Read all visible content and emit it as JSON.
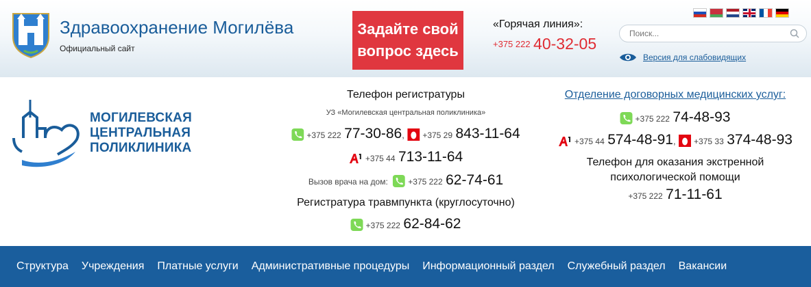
{
  "header": {
    "title": "Здравоохранение Могилёва",
    "subtitle": "Официальный сайт",
    "ask_button": {
      "line1": "Задайте свой",
      "line2": "вопрос здесь"
    },
    "hotline": {
      "label": "«Горячая линия»:",
      "prefix": "+375 222",
      "number": "40-32-05"
    },
    "search": {
      "placeholder": "Поиск..."
    },
    "low_vision_link": "Версия для слабовидящих",
    "flags": [
      "ru",
      "by",
      "nl",
      "gb",
      "fr",
      "de"
    ]
  },
  "clinic": {
    "name_lines": [
      "МОГИЛЕВСКАЯ",
      "ЦЕНТРАЛЬНАЯ",
      "ПОЛИКЛИНИКА"
    ]
  },
  "registry": {
    "title": "Телефон регистратуры",
    "org": "УЗ «Могилевская центральная поликлиника»",
    "phone1": {
      "prefix": "+375 222",
      "number": "77-30-86"
    },
    "phone2": {
      "prefix": "+375 29",
      "number": "843-11-64"
    },
    "phone3": {
      "prefix": "+375 44",
      "number": "713-11-64"
    },
    "home_call": {
      "label": "Вызов врача на дом:",
      "prefix": "+375 222",
      "number": "62-74-61"
    },
    "trauma_title": "Регистратура травмпункта (круглосуточно)",
    "trauma_phone": {
      "prefix": "+375 222",
      "number": "62-84-62"
    }
  },
  "paid": {
    "link": "Отделение договорных медицинских услуг:",
    "phone1": {
      "prefix": "+375 222",
      "number": "74-48-93"
    },
    "phone2": {
      "prefix": "+375 44",
      "number": "574-48-91"
    },
    "phone3": {
      "prefix": "+375 33",
      "number": "374-48-93"
    },
    "psych_line1": "Телефон для оказания экстренной",
    "psych_line2": "психологической помощи",
    "psych_phone": {
      "prefix": "+375 222",
      "number": "71-11-61"
    }
  },
  "nav": {
    "items": [
      "Структура",
      "Учреждения",
      "Платные услуги",
      "Административные процедуры",
      "Информационный раздел",
      "Служебный раздел",
      "Вакансии"
    ]
  },
  "colors": {
    "brand_blue": "#1a5d9a",
    "nav_bg": "#1a5e9d",
    "accent_red": "#e0373f",
    "phone_green": "#7ed957"
  }
}
